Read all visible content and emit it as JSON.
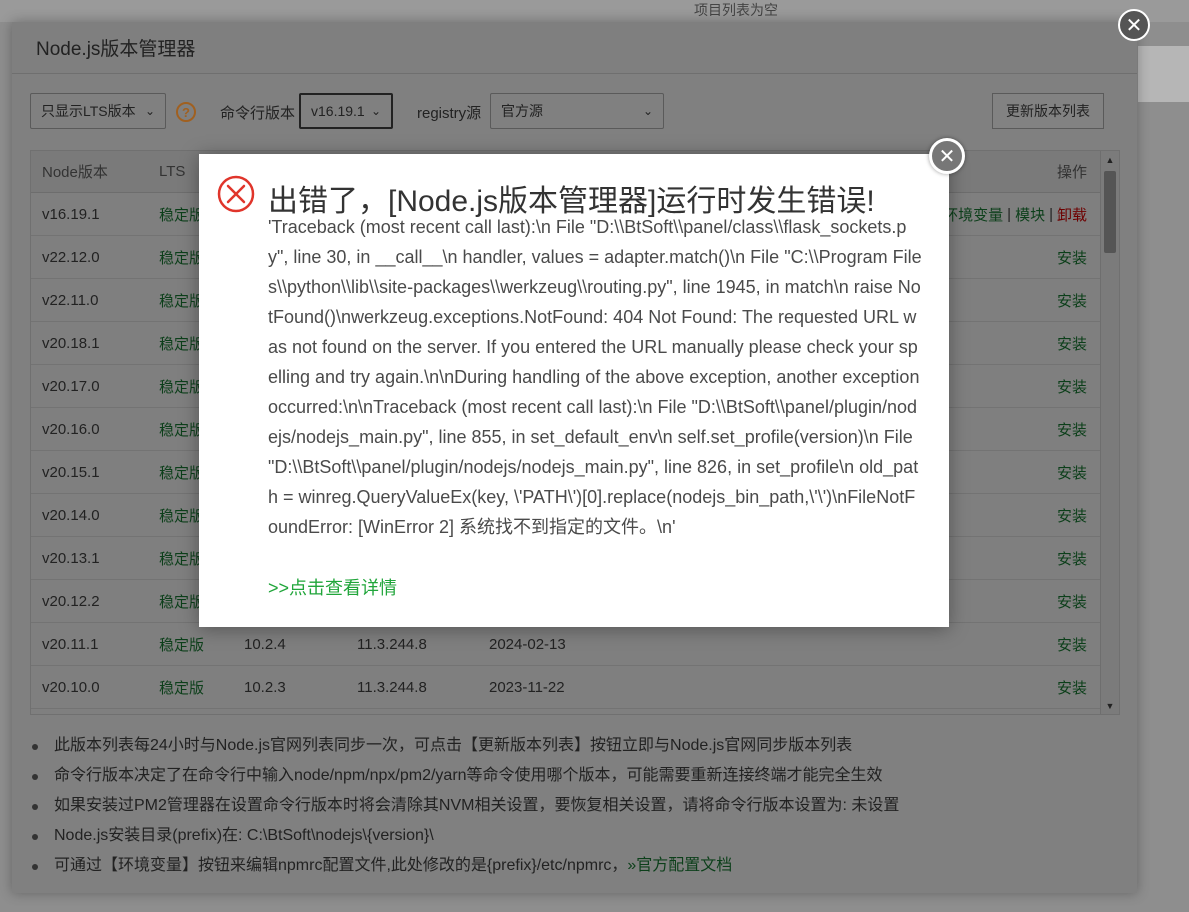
{
  "background": {
    "top_text": "项目列表为空"
  },
  "dialog": {
    "title": "Node.js版本管理器",
    "toolbar": {
      "filter_select": "只显示LTS版本",
      "cli_version_label": "命令行版本",
      "cli_version_select": "v16.19.1",
      "registry_label": "registry源",
      "registry_select": "官方源",
      "refresh_button": "更新版本列表"
    },
    "table": {
      "headers": {
        "version": "Node版本",
        "lts": "LTS",
        "op": "操作"
      },
      "rows": [
        {
          "version": "v16.19.1",
          "lts": "稳定版",
          "npm": "",
          "v8": "",
          "date": ""
        },
        {
          "version": "v22.12.0",
          "lts": "稳定版",
          "npm": "",
          "v8": "",
          "date": "",
          "op": "安装"
        },
        {
          "version": "v22.11.0",
          "lts": "稳定版",
          "npm": "",
          "v8": "",
          "date": "",
          "op": "安装"
        },
        {
          "version": "v20.18.1",
          "lts": "稳定版",
          "npm": "",
          "v8": "",
          "date": "",
          "op": "安装"
        },
        {
          "version": "v20.17.0",
          "lts": "稳定版",
          "npm": "",
          "v8": "",
          "date": "",
          "op": "安装"
        },
        {
          "version": "v20.16.0",
          "lts": "稳定版",
          "npm": "",
          "v8": "",
          "date": "",
          "op": "安装"
        },
        {
          "version": "v20.15.1",
          "lts": "稳定版",
          "npm": "",
          "v8": "",
          "date": "",
          "op": "安装"
        },
        {
          "version": "v20.14.0",
          "lts": "稳定版",
          "npm": "",
          "v8": "",
          "date": "",
          "op": "安装"
        },
        {
          "version": "v20.13.1",
          "lts": "稳定版",
          "npm": "",
          "v8": "",
          "date": "",
          "op": "安装"
        },
        {
          "version": "v20.12.2",
          "lts": "稳定版",
          "npm": "",
          "v8": "",
          "date": "",
          "op": "安装"
        },
        {
          "version": "v20.11.1",
          "lts": "稳定版",
          "npm": "10.2.4",
          "v8": "11.3.244.8",
          "date": "2024-02-13",
          "op": "安装"
        },
        {
          "version": "v20.10.0",
          "lts": "稳定版",
          "npm": "10.2.3",
          "v8": "11.3.244.8",
          "date": "2023-11-22",
          "op": "安装"
        }
      ],
      "first_row_ops": {
        "env": "环境变量",
        "sep": "|",
        "modules": "模块",
        "uninstall": "卸载"
      }
    },
    "notes": [
      "此版本列表每24小时与Node.js官网列表同步一次，可点击【更新版本列表】按钮立即与Node.js官网同步版本列表",
      "命令行版本决定了在命令行中输入node/npm/npx/pm2/yarn等命令使用哪个版本，可能需要重新连接终端才能完全生效",
      "如果安装过PM2管理器在设置命令行版本时将会清除其NVM相关设置，要恢复相关设置，请将命令行版本设置为: 未设置",
      "Node.js安装目录(prefix)在: C:\\BtSoft\\nodejs\\{version}\\",
      "可通过【环境变量】按钮来编辑npmrc配置文件,此处修改的是{prefix}/etc/npmrc，"
    ],
    "notes_link": "»官方配置文档"
  },
  "error": {
    "title": "出错了，[Node.js版本管理器]运行时发生错误!",
    "traceback": "'Traceback (most recent call last):\\n File \"D:\\\\BtSoft\\\\panel/class\\\\flask_sockets.py\", line 30, in __call__\\n handler, values = adapter.match()\\n File \"C:\\\\Program Files\\\\python\\\\lib\\\\site-packages\\\\werkzeug\\\\routing.py\", line 1945, in match\\n raise NotFound()\\nwerkzeug.exceptions.NotFound: 404 Not Found: The requested URL was not found on the server. If you entered the URL manually please check your spelling and try again.\\n\\nDuring handling of the above exception, another exception occurred:\\n\\nTraceback (most recent call last):\\n File \"D:\\\\BtSoft\\\\panel/plugin/nodejs/nodejs_main.py\", line 855, in set_default_env\\n self.set_profile(version)\\n File \"D:\\\\BtSoft\\\\panel/plugin/nodejs/nodejs_main.py\", line 826, in set_profile\\n old_path = winreg.QueryValueEx(key, \\'PATH\\')[0].replace(nodejs_bin_path,\\'\\')\\nFileNotFoundError: [WinError 2] 系统找不到指定的文件。\\n'",
    "details_link": ">>点击查看详情",
    "close_glyph": "✕"
  },
  "colors": {
    "link_green": "#20a53a",
    "error_red": "#e0352b"
  }
}
